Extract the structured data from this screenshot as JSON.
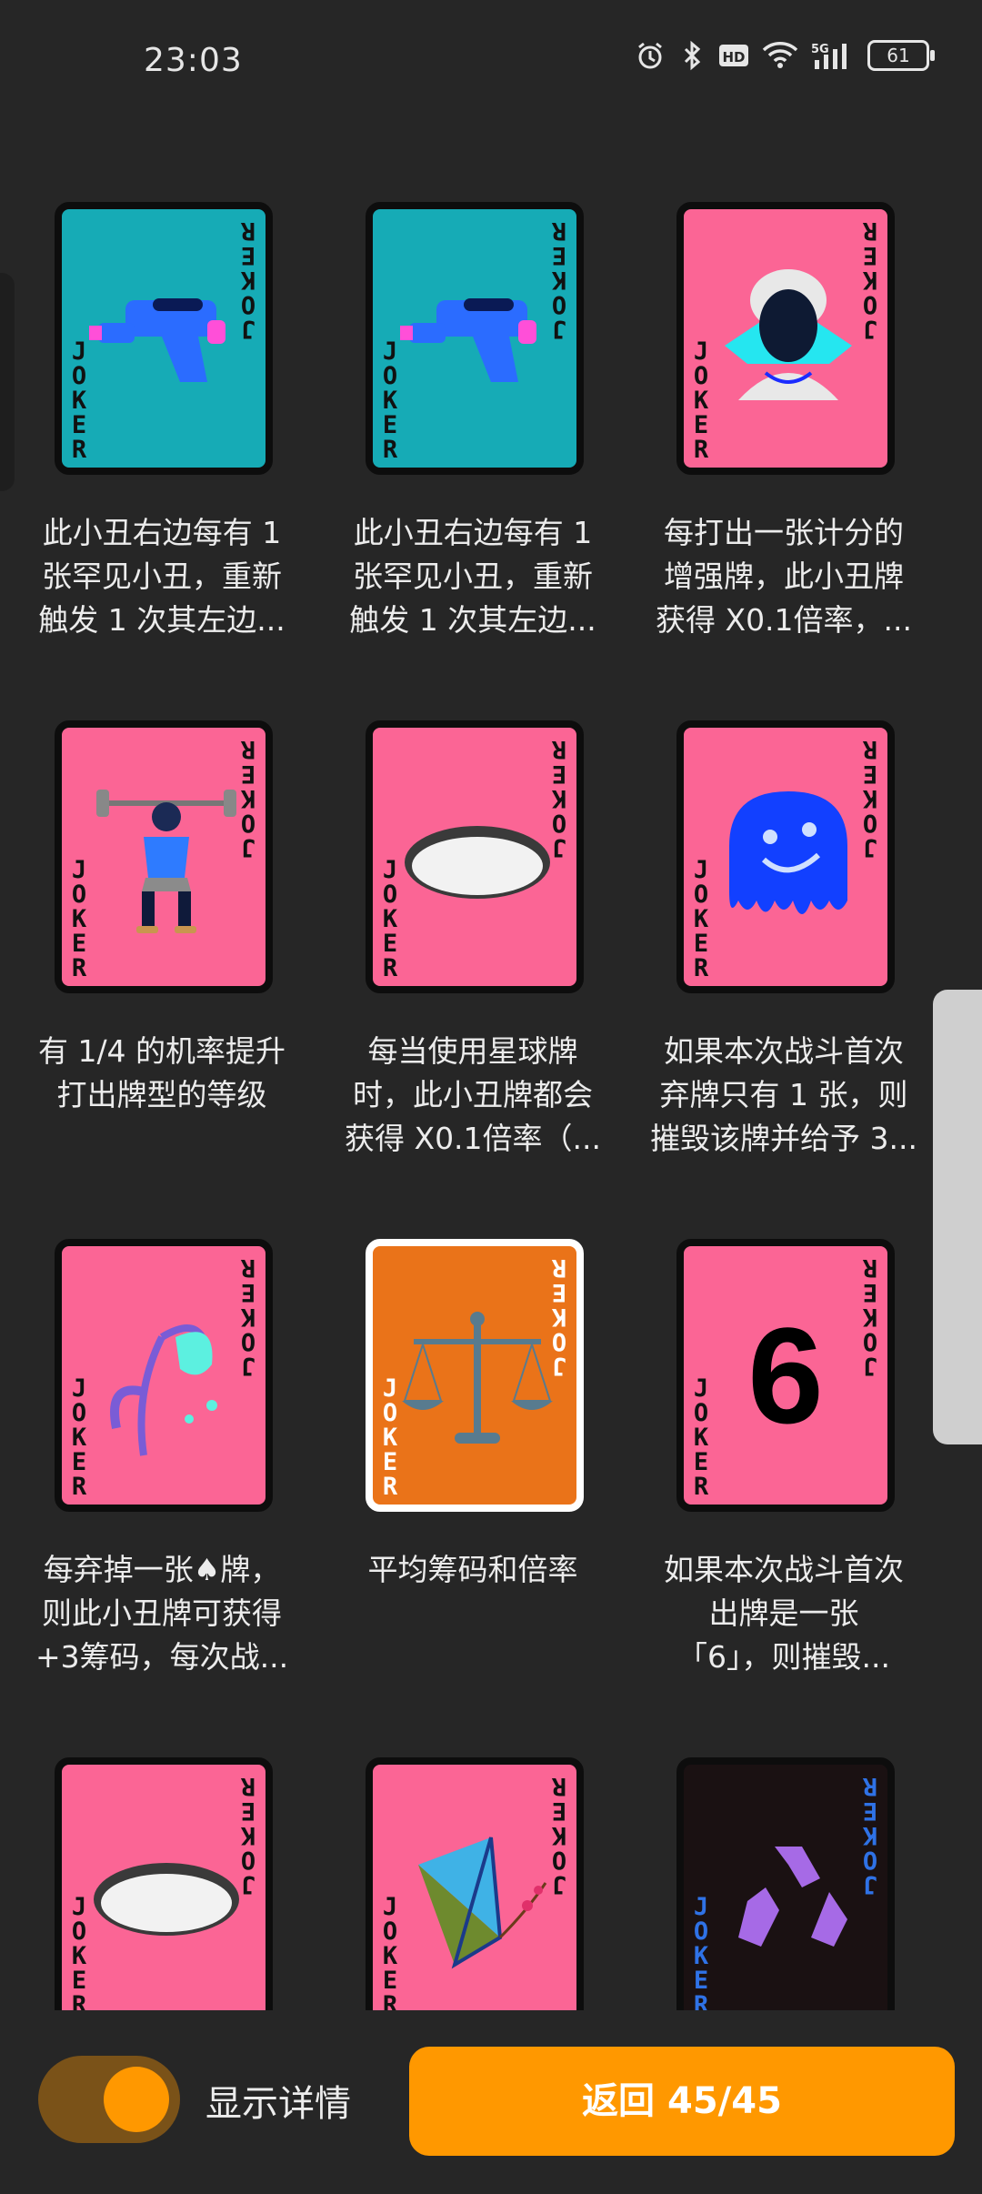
{
  "status_bar": {
    "time": "23:03",
    "battery": "61"
  },
  "cards": [
    {
      "desc": "此小丑右边每有 1\n张罕见小丑，重新\n触发 1 次其左边..."
    },
    {
      "desc": "此小丑右边每有 1\n张罕见小丑，重新\n触发 1 次其左边..."
    },
    {
      "desc": "每打出一张计分的\n增强牌，此小丑牌\n获得 X0.1倍率，..."
    },
    {
      "desc": "有 1/4 的机率提升\n打出牌型的等级"
    },
    {
      "desc": "每当使用星球牌\n时，此小丑牌都会\n获得 X0.1倍率（..."
    },
    {
      "desc": "如果本次战斗首次\n弃牌只有 1 张，则\n摧毁该牌并给予 3..."
    },
    {
      "desc": "每弃掉一张♠牌，\n则此小丑牌可获得\n+3筹码，每次战..."
    },
    {
      "desc": "平均筹码和倍率"
    },
    {
      "desc": "如果本次战斗首次\n出牌是一张\n「6」，则摧毁..."
    },
    {
      "desc": ""
    },
    {
      "desc": ""
    },
    {
      "desc": ""
    }
  ],
  "card_face": {
    "joker": "JOKER",
    "six": "6"
  },
  "footer": {
    "toggle_label": "显示详情",
    "return_label": "返回 45/45"
  },
  "colors": {
    "accent": "#ff9800",
    "teal": "#16abb6",
    "pink": "#fb6595",
    "orange_card": "#ea7319",
    "background": "#262626"
  }
}
